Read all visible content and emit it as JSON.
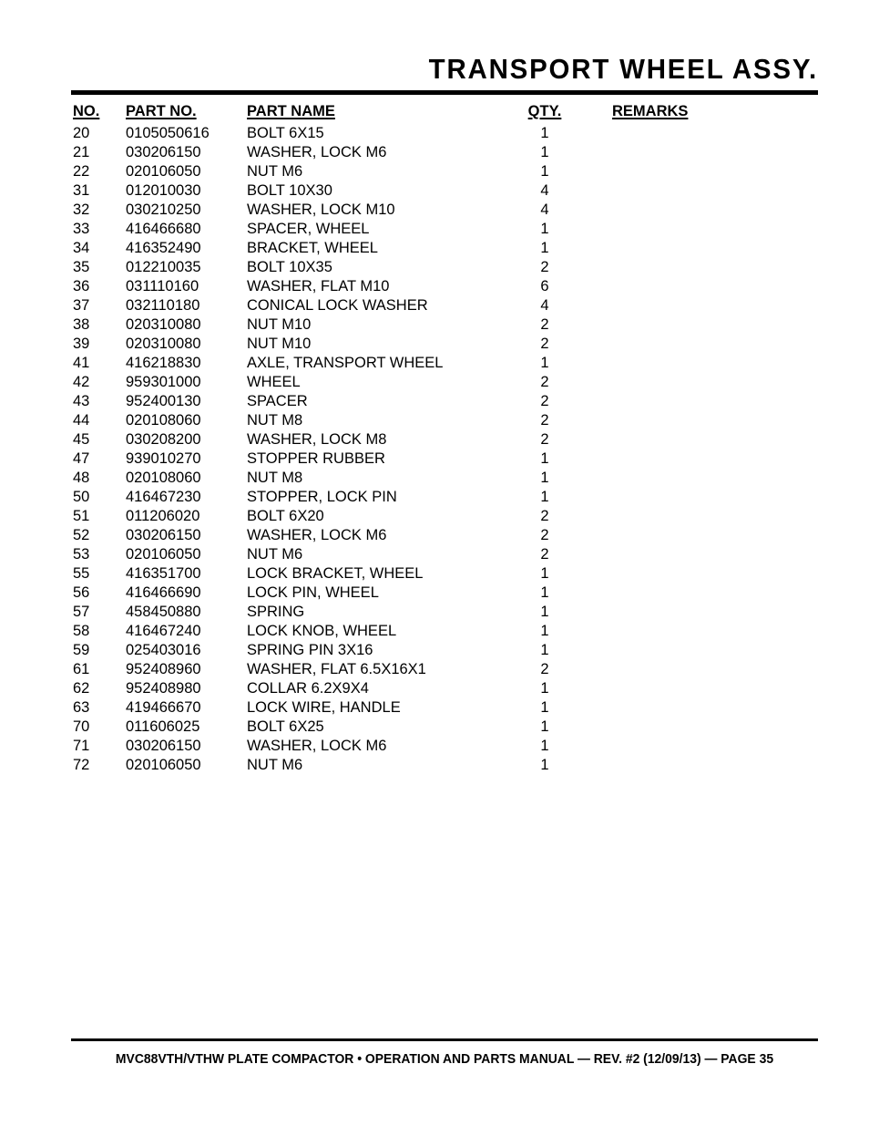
{
  "document": {
    "title": "TRANSPORT WHEEL ASSY.",
    "footer": "MVC88VTH/VTHW PLATE COMPACTOR • OPERATION AND PARTS MANUAL — REV. #2 (12/09/13) — PAGE 35"
  },
  "table": {
    "headers": {
      "no": "NO.",
      "part_no": "PART NO.",
      "part_name": "PART NAME",
      "qty": "QTY.",
      "remarks": "REMARKS"
    },
    "rows": [
      {
        "no": "20",
        "part_no": "0105050616",
        "part_name": "BOLT 6X15",
        "qty": "1",
        "remarks": ""
      },
      {
        "no": "21",
        "part_no": "030206150",
        "part_name": "WASHER, LOCK M6",
        "qty": "1",
        "remarks": ""
      },
      {
        "no": "22",
        "part_no": "020106050",
        "part_name": "NUT M6",
        "qty": "1",
        "remarks": ""
      },
      {
        "no": "31",
        "part_no": "012010030",
        "part_name": "BOLT 10X30",
        "qty": "4",
        "remarks": ""
      },
      {
        "no": "32",
        "part_no": "030210250",
        "part_name": "WASHER, LOCK M10",
        "qty": "4",
        "remarks": ""
      },
      {
        "no": "33",
        "part_no": "416466680",
        "part_name": "SPACER, WHEEL",
        "qty": "1",
        "remarks": ""
      },
      {
        "no": "34",
        "part_no": "416352490",
        "part_name": "BRACKET, WHEEL",
        "qty": "1",
        "remarks": ""
      },
      {
        "no": "35",
        "part_no": "012210035",
        "part_name": "BOLT 10X35",
        "qty": "2",
        "remarks": ""
      },
      {
        "no": "36",
        "part_no": "031110160",
        "part_name": "WASHER, FLAT M10",
        "qty": "6",
        "remarks": ""
      },
      {
        "no": "37",
        "part_no": "032110180",
        "part_name": "CONICAL LOCK WASHER",
        "qty": "4",
        "remarks": ""
      },
      {
        "no": "38",
        "part_no": "020310080",
        "part_name": "NUT M10",
        "qty": "2",
        "remarks": ""
      },
      {
        "no": "39",
        "part_no": "020310080",
        "part_name": "NUT M10",
        "qty": "2",
        "remarks": ""
      },
      {
        "no": "41",
        "part_no": "416218830",
        "part_name": "AXLE, TRANSPORT WHEEL",
        "qty": "1",
        "remarks": ""
      },
      {
        "no": "42",
        "part_no": "959301000",
        "part_name": "WHEEL",
        "qty": "2",
        "remarks": ""
      },
      {
        "no": "43",
        "part_no": "952400130",
        "part_name": "SPACER",
        "qty": "2",
        "remarks": ""
      },
      {
        "no": "44",
        "part_no": "020108060",
        "part_name": "NUT M8",
        "qty": "2",
        "remarks": ""
      },
      {
        "no": "45",
        "part_no": "030208200",
        "part_name": "WASHER, LOCK M8",
        "qty": "2",
        "remarks": ""
      },
      {
        "no": "47",
        "part_no": "939010270",
        "part_name": "STOPPER RUBBER",
        "qty": "1",
        "remarks": ""
      },
      {
        "no": "48",
        "part_no": "020108060",
        "part_name": "NUT M8",
        "qty": "1",
        "remarks": ""
      },
      {
        "no": "50",
        "part_no": "416467230",
        "part_name": "STOPPER, LOCK PIN",
        "qty": "1",
        "remarks": ""
      },
      {
        "no": "51",
        "part_no": "011206020",
        "part_name": "BOLT 6X20",
        "qty": "2",
        "remarks": ""
      },
      {
        "no": "52",
        "part_no": "030206150",
        "part_name": "WASHER, LOCK M6",
        "qty": "2",
        "remarks": ""
      },
      {
        "no": "53",
        "part_no": "020106050",
        "part_name": "NUT M6",
        "qty": "2",
        "remarks": ""
      },
      {
        "no": "55",
        "part_no": "416351700",
        "part_name": "LOCK BRACKET, WHEEL",
        "qty": "1",
        "remarks": ""
      },
      {
        "no": "56",
        "part_no": "416466690",
        "part_name": "LOCK PIN, WHEEL",
        "qty": "1",
        "remarks": ""
      },
      {
        "no": "57",
        "part_no": "458450880",
        "part_name": "SPRING",
        "qty": "1",
        "remarks": ""
      },
      {
        "no": "58",
        "part_no": "416467240",
        "part_name": "LOCK KNOB, WHEEL",
        "qty": "1",
        "remarks": ""
      },
      {
        "no": "59",
        "part_no": "025403016",
        "part_name": "SPRING PIN 3X16",
        "qty": "1",
        "remarks": ""
      },
      {
        "no": "61",
        "part_no": "952408960",
        "part_name": "WASHER, FLAT 6.5X16X1",
        "qty": "2",
        "remarks": ""
      },
      {
        "no": "62",
        "part_no": "952408980",
        "part_name": "COLLAR 6.2X9X4",
        "qty": "1",
        "remarks": ""
      },
      {
        "no": "63",
        "part_no": "419466670",
        "part_name": "LOCK WIRE, HANDLE",
        "qty": "1",
        "remarks": ""
      },
      {
        "no": "70",
        "part_no": "011606025",
        "part_name": "BOLT 6X25",
        "qty": "1",
        "remarks": ""
      },
      {
        "no": "71",
        "part_no": "030206150",
        "part_name": "WASHER, LOCK M6",
        "qty": "1",
        "remarks": ""
      },
      {
        "no": "72",
        "part_no": "020106050",
        "part_name": "NUT M6",
        "qty": "1",
        "remarks": ""
      }
    ]
  }
}
